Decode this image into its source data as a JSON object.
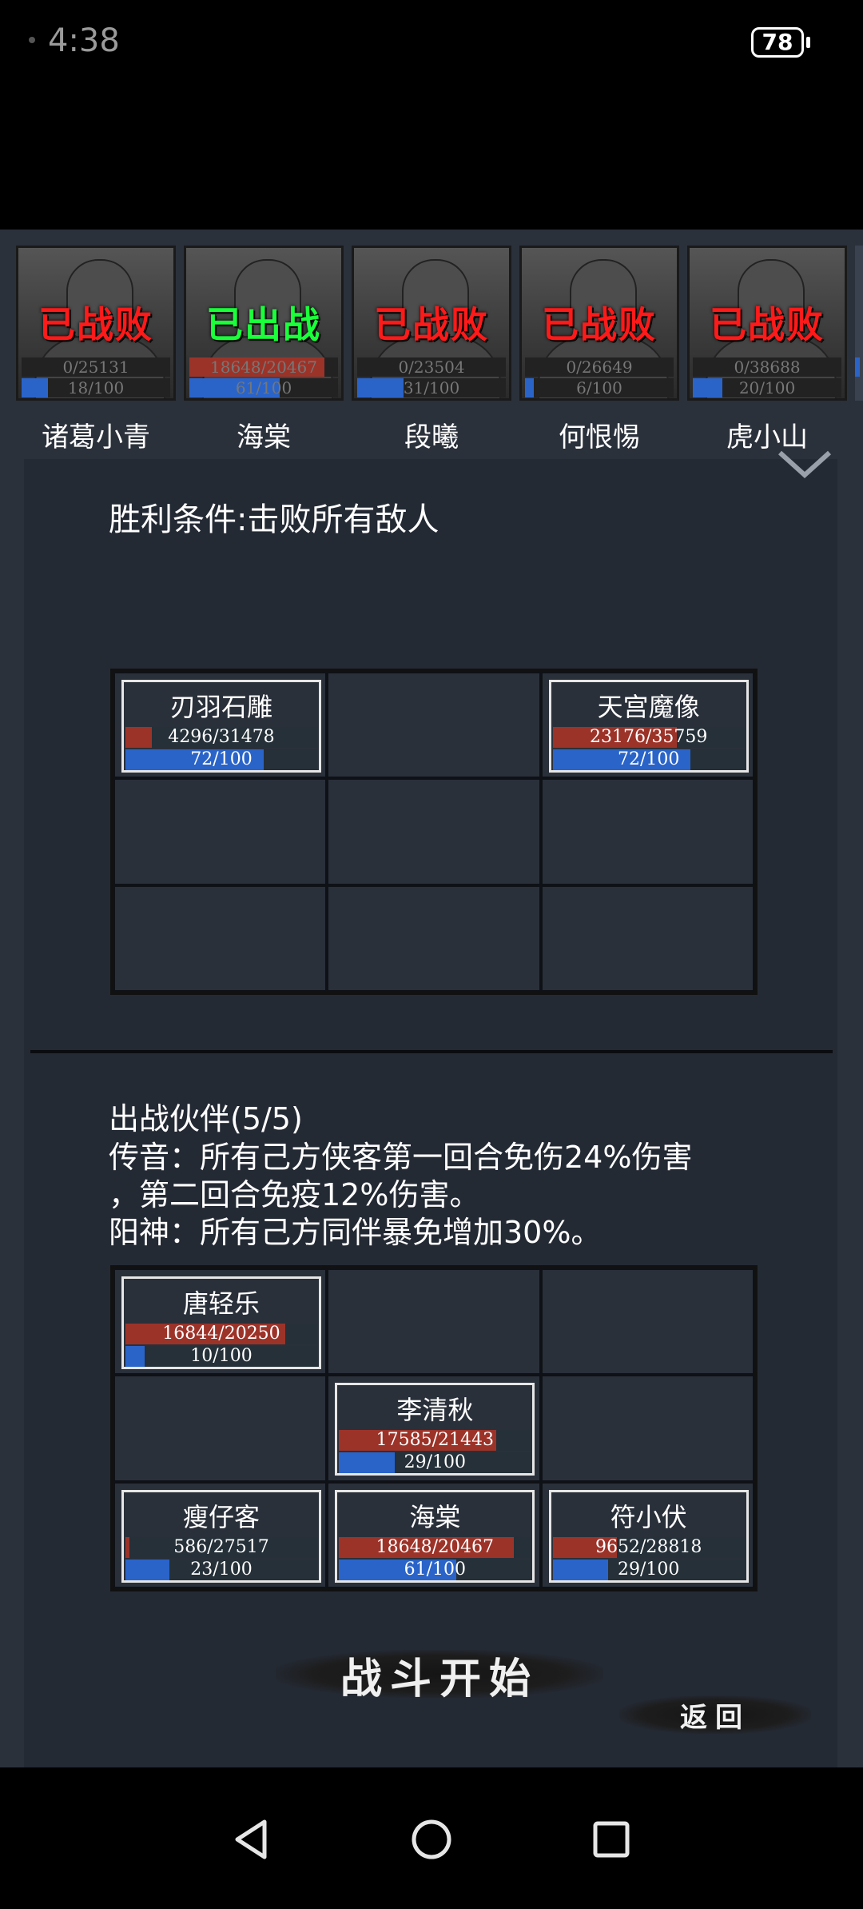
{
  "status_bar": {
    "time": "4:38",
    "battery": "78"
  },
  "roster": [
    {
      "name": "诸葛小青",
      "status": "已战败",
      "state": "lost",
      "hp": "0/25131",
      "hp_frac": 0.0,
      "mp": "18/100",
      "mp_frac": 0.18
    },
    {
      "name": "海棠",
      "status": "已出战",
      "state": "active",
      "hp": "18648/20467",
      "hp_frac": 0.91,
      "mp": "61/100",
      "mp_frac": 0.61
    },
    {
      "name": "段曦",
      "status": "已战败",
      "state": "lost",
      "hp": "0/23504",
      "hp_frac": 0.0,
      "mp": "31/100",
      "mp_frac": 0.31
    },
    {
      "name": "何恨惕",
      "status": "已战败",
      "state": "lost",
      "hp": "0/26649",
      "hp_frac": 0.0,
      "mp": "6/100",
      "mp_frac": 0.06
    },
    {
      "name": "虎小山",
      "status": "已战败",
      "state": "lost",
      "hp": "0/38688",
      "hp_frac": 0.0,
      "mp": "20/100",
      "mp_frac": 0.2
    }
  ],
  "victory_condition": "胜利条件:击败所有敌人",
  "enemies": [
    {
      "name": "刃羽石雕",
      "hp": "4296/31478",
      "hp_frac": 0.136,
      "mp": "72/100",
      "mp_frac": 0.72
    },
    null,
    {
      "name": "天宫魔像",
      "hp": "23176/35759",
      "hp_frac": 0.648,
      "mp": "72/100",
      "mp_frac": 0.72
    },
    null,
    null,
    null,
    null,
    null,
    null
  ],
  "allies_title": "出战伙伴(5/5)",
  "buff_lines": [
    "传音：所有己方侠客第一回合免伤24%伤害",
    "，第二回合免疫12%伤害。",
    "阳神：所有己方同伴暴免增加30%。"
  ],
  "allies": [
    {
      "name": "唐轻乐",
      "hp": "16844/20250",
      "hp_frac": 0.832,
      "mp": "10/100",
      "mp_frac": 0.1
    },
    null,
    null,
    null,
    {
      "name": "李清秋",
      "hp": "17585/21443",
      "hp_frac": 0.82,
      "mp": "29/100",
      "mp_frac": 0.29
    },
    null,
    {
      "name": "瘦仔客",
      "hp": "586/27517",
      "hp_frac": 0.021,
      "mp": "23/100",
      "mp_frac": 0.23
    },
    {
      "name": "海棠",
      "hp": "18648/20467",
      "hp_frac": 0.911,
      "mp": "61/100",
      "mp_frac": 0.61
    },
    {
      "name": "符小伏",
      "hp": "9652/28818",
      "hp_frac": 0.335,
      "mp": "29/100",
      "mp_frac": 0.29
    }
  ],
  "buttons": {
    "start": "战斗开始",
    "back": "返回"
  },
  "colors": {
    "hp": "#9c3329",
    "mp": "#2a64c9",
    "lost": "#ff1a1a",
    "active": "#1aff3a",
    "panel": "#242a34"
  }
}
